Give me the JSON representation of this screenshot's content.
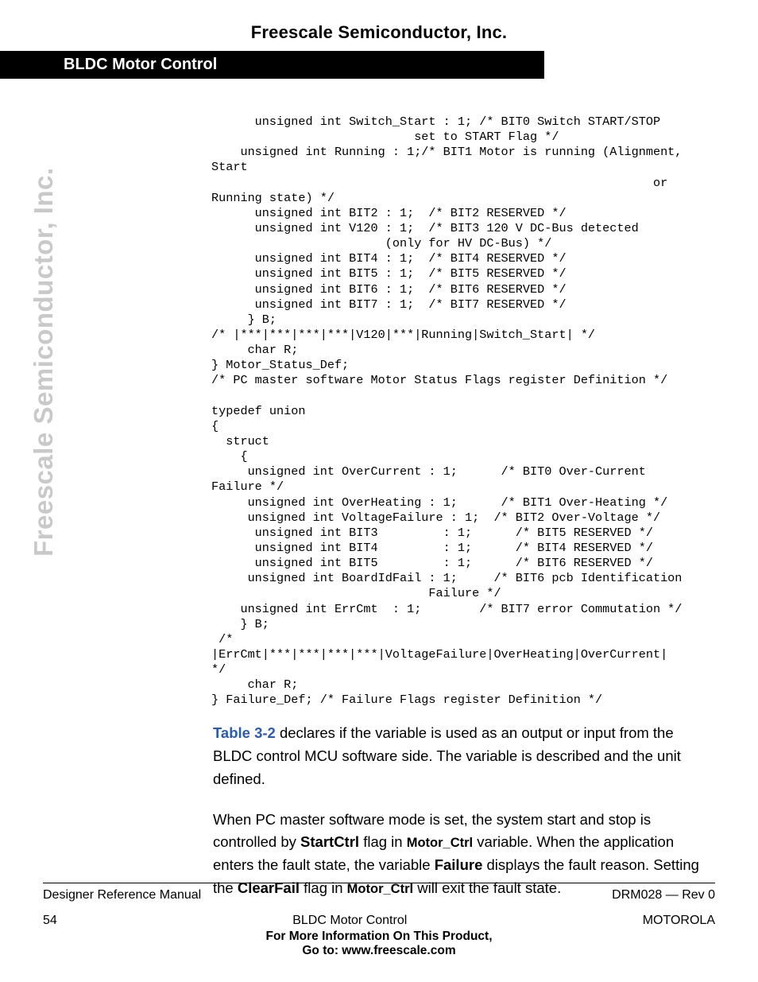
{
  "header": {
    "company": "Freescale Semiconductor, Inc.",
    "section": "BLDC Motor Control",
    "side": "Freescale Semiconductor, Inc."
  },
  "code": "      unsigned int Switch_Start : 1; /* BIT0 Switch START/STOP\n                            set to START Flag */\n    unsigned int Running : 1;/* BIT1 Motor is running (Alignment,\nStart \n                                                             or\nRunning state) */\n      unsigned int BIT2 : 1;  /* BIT2 RESERVED */\n      unsigned int V120 : 1;  /* BIT3 120 V DC-Bus detected \n                        (only for HV DC-Bus) */\n      unsigned int BIT4 : 1;  /* BIT4 RESERVED */\n      unsigned int BIT5 : 1;  /* BIT5 RESERVED */\n      unsigned int BIT6 : 1;  /* BIT6 RESERVED */\n      unsigned int BIT7 : 1;  /* BIT7 RESERVED */\n     } B;\n/* |***|***|***|***|V120|***|Running|Switch_Start| */\n     char R;\n} Motor_Status_Def;\n/* PC master software Motor Status Flags register Definition */\n\ntypedef union\n{\n  struct\n    {\n     unsigned int OverCurrent : 1;      /* BIT0 Over-Current\nFailure */\n     unsigned int OverHeating : 1;      /* BIT1 Over-Heating */\n     unsigned int VoltageFailure : 1;  /* BIT2 Over-Voltage */\n      unsigned int BIT3         : 1;      /* BIT5 RESERVED */\n      unsigned int BIT4         : 1;      /* BIT4 RESERVED */\n      unsigned int BIT5         : 1;      /* BIT6 RESERVED */\n     unsigned int BoardIdFail : 1;     /* BIT6 pcb Identification\n                              Failure */\n    unsigned int ErrCmt  : 1;        /* BIT7 error Commutation */\n    } B;\n /*\n|ErrCmt|***|***|***|***|VoltageFailure|OverHeating|OverCurrent| \n*/\n     char R;\n} Failure_Def; /* Failure Flags register Definition */",
  "para1": {
    "link": "Table 3-2",
    "t1": " declares if the variable is used as an output or input from the BLDC control MCU software side. The variable is described and the unit defined."
  },
  "para2": {
    "t1": "When PC master software mode is set, the system start and stop is controlled by ",
    "b1": "StartCtrl",
    "t2": " flag in ",
    "m1": "Motor_Ctrl",
    "t3": " variable. When the application enters the fault state, the variable ",
    "b2": "Failure",
    "t4": " displays the fault reason. Setting the ",
    "b3": "ClearFail",
    "t5": " flag in ",
    "m2": "Motor_Ctrl",
    "t6": " will exit the fault state."
  },
  "footer": {
    "left1": "Designer Reference Manual",
    "right1": "DRM028 — Rev 0",
    "left2": "54",
    "mid2": "BLDC Motor Control",
    "right2": "MOTOROLA",
    "info1": "For More Information On This Product,",
    "info2": "Go to: www.freescale.com"
  }
}
